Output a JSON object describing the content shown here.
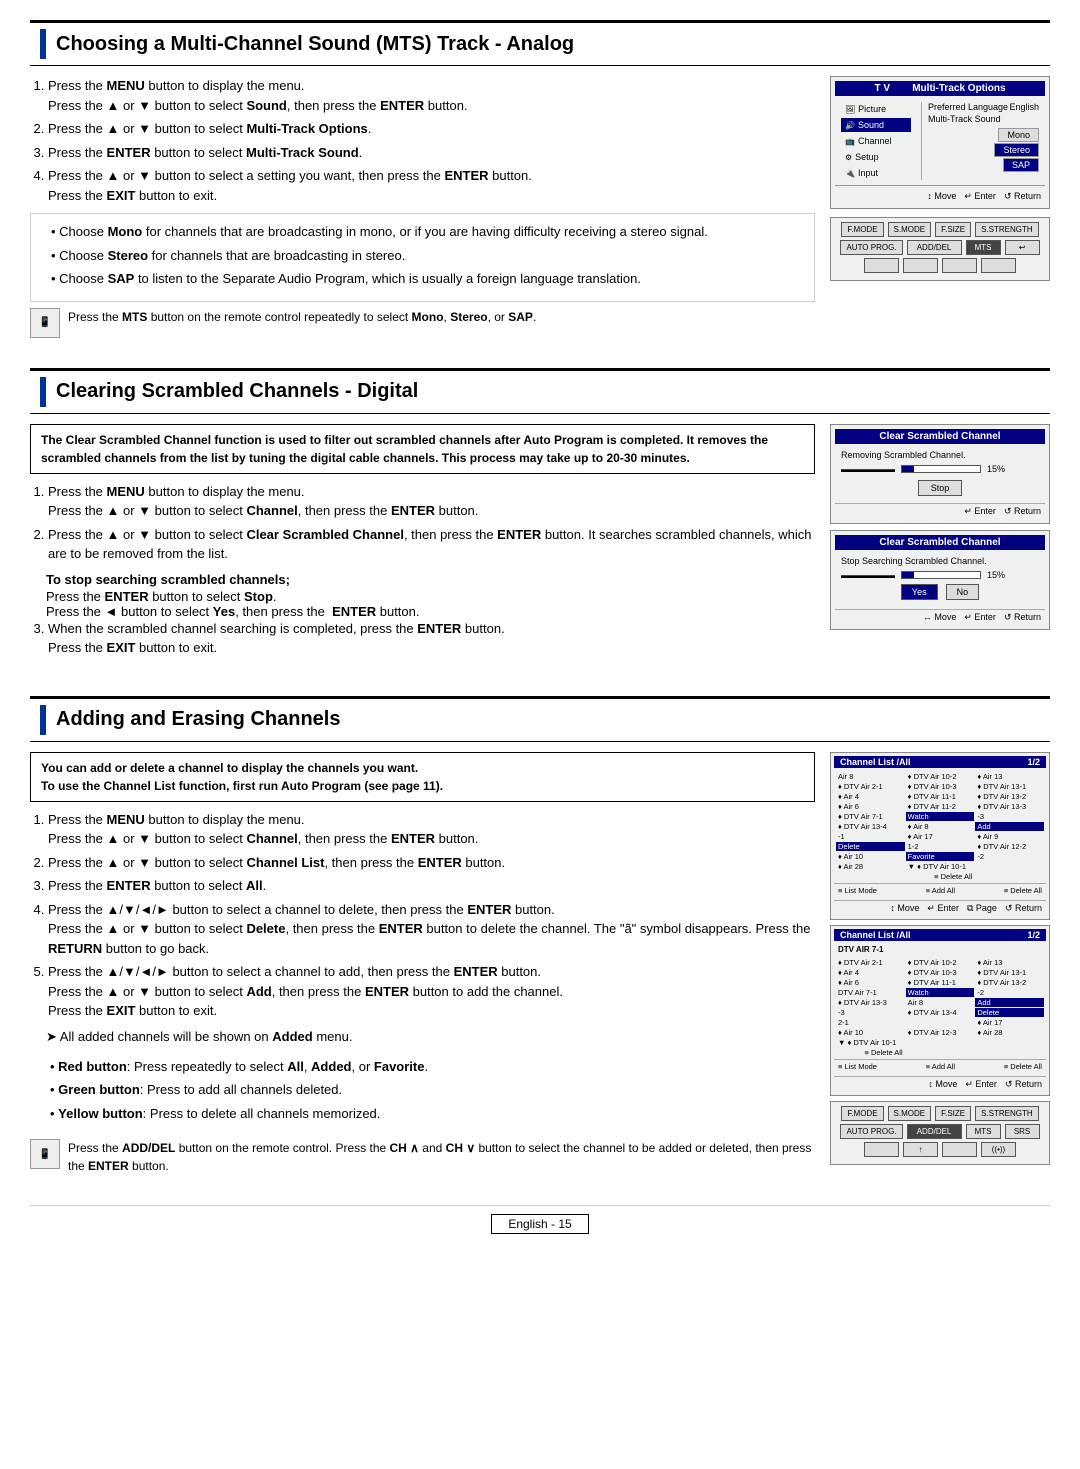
{
  "sections": [
    {
      "id": "mts",
      "title": "Choosing a Multi-Channel Sound (MTS) Track - Analog",
      "steps": [
        {
          "num": 1,
          "text": "Press the MENU button to display the menu.",
          "sub": "Press the ▲ or ▼ button to select Sound, then press the ENTER button."
        },
        {
          "num": 2,
          "text": "Press the ▲ or ▼ button to select Multi-Track Options."
        },
        {
          "num": 3,
          "text": "Press the ENTER button to select Multi-Track Sound."
        },
        {
          "num": 4,
          "text": "Press the ▲ or ▼ button to select a setting you want, then press the ENTER button.",
          "sub": "Press the EXIT button to exit."
        }
      ],
      "notes": [
        "Choose Mono for channels that are broadcasting in mono, or if you are having difficulty receiving a stereo signal.",
        "Choose Stereo for channels that are broadcasting in stereo.",
        "Choose SAP to listen to the Separate Audio Program, which is usually a foreign language translation."
      ],
      "remote_note": "Press the MTS button on the remote control repeatedly to select Mono, Stereo, or SAP."
    },
    {
      "id": "scrambled",
      "title": "Clearing Scrambled Channels - Digital",
      "warning": "The Clear Scrambled Channel function is used to filter out scrambled channels after Auto Program is completed. It removes the scrambled channels from the list by tuning the digital cable channels. This process may take up to 20-30 minutes.",
      "steps": [
        {
          "num": 1,
          "text": "Press the MENU button to display the menu.",
          "sub": "Press the ▲ or ▼ button to select Channel, then press the ENTER button."
        },
        {
          "num": 2,
          "text": "Press the ▲ or ▼ button to select Clear Scrambled Channel, then press the ENTER button. It searches scrambled channels, which are to be removed from the list."
        }
      ],
      "stop_section": {
        "title": "To stop searching scrambled channels;",
        "lines": [
          "Press the ENTER button to select Stop.",
          "Press the ◄ button to select Yes, then press the ENTER button."
        ]
      },
      "step3": "When the scrambled channel searching is completed, press the ENTER button.",
      "step3_sub": "Press the EXIT button to exit."
    },
    {
      "id": "adding",
      "title": "Adding and Erasing Channels",
      "intro1": "You can add or delete a channel to display the channels you want.",
      "intro2": "To use the Channel List function, first run Auto Program (see page 11).",
      "steps": [
        {
          "num": 1,
          "text": "Press the MENU button to display the menu.",
          "sub": "Press the ▲ or ▼ button to select Channel, then press the ENTER button."
        },
        {
          "num": 2,
          "text": "Press the ▲ or ▼ button to select Channel List, then press the ENTER button."
        },
        {
          "num": 3,
          "text": "Press the ENTER button to select All."
        },
        {
          "num": 4,
          "text": "Press the ▲/▼/◄/► button to select a channel to delete, then press the ENTER button.",
          "sub2": "Press the ▲ or ▼ button to select Delete, then press the ENTER button to delete the channel. The \"\" symbol disappears. Press the RETURN button to go back."
        },
        {
          "num": 5,
          "text": "Press the ▲/▼/◄/► button to select a channel to add, then press the ENTER button.",
          "sub2": "Press the ▲ or ▼ button to select Add, then press the ENTER button to add the channel.",
          "sub": "Press the EXIT button to exit."
        }
      ],
      "note_arrow": "➤ All added channels will be shown on Added menu.",
      "bullets": [
        "Red button: Press repeatedly to select All, Added, or Favorite.",
        "Green button: Press to add all channels deleted.",
        "Yellow button: Press to delete all channels memorized."
      ],
      "remote_note": "Press the ADD/DEL button on the remote control. Press the CH ∧ and CH ∨ button to select the channel to be added or deleted, then press the ENTER button."
    }
  ],
  "footer": {
    "label": "English - 15"
  },
  "tv_panel": {
    "title": "T V    Multi-Track Options",
    "preferred_lang": "Preferred Language",
    "lang_value": "English",
    "multi_track": "Multi-Track Sound",
    "options": [
      "Mono",
      "Stereo",
      "SAP"
    ],
    "selected": "Mono",
    "nav": "↕ Move  ↵ Enter  ↺ Return"
  },
  "scramble_panel1": {
    "title": "Clear Scrambled Channel",
    "body": "Removing Scrambled Channel.",
    "progress": 15,
    "stop_label": "Stop",
    "nav": "↵ Enter  ↺ Return"
  },
  "scramble_panel2": {
    "title": "Clear Scrambled Channel",
    "body": "Stop Searching Scrambled Channel.",
    "progress": 15,
    "yes": "Yes",
    "no": "No",
    "nav": "↔ Move  ↵ Enter  ↺ Return"
  },
  "channel_panels": {
    "panel1_title": "Channel List /All",
    "panel1_page": "1/2",
    "panel1_items": [
      "Air 8",
      "♦ DTV Air 10-2",
      "♦ Air 13",
      "♦ DTV Air 2-1",
      "♦ DTV Air 10-3",
      "♦ DTV Air 13-1",
      "♦ Air 4",
      "♦ DTV Air 11-1",
      "♦ DTV Air 13-2",
      "♦ Air 6",
      "♦ DTV Air 11-2",
      "♦ DTV Air 13-3",
      "♦ DTV Air 7-1",
      "Watch",
      "-3",
      "♦ DTV Air 13-4",
      "♦ Air 8",
      "Add",
      "-1",
      "♦ Air 17",
      "♦ Air 9",
      "Delete",
      "1-2",
      "♦ DTV Air 12-2",
      "♦ Air 10",
      "Favorite",
      "-2",
      "♦ Air 28",
      "▼ ♦ DTV Air 10-1",
      "",
      "",
      "≡ Delete All"
    ],
    "panel2_title": "Channel List /All",
    "panel2_page": "1/2",
    "panel2_items": [
      "DTV AIR 7-1",
      "",
      "",
      "",
      "♦ DTV Air 2-1",
      "♦ DTV Air 10-2",
      "♦ Air 13",
      "♦ Air 4",
      "♦ DTV Air 10-3",
      "♦ DTV Air 13-1",
      "♦ Air 6",
      "♦ DTV Air 11-1",
      "♦ DTV Air 13-2",
      "DTV Air 7-1",
      "Watch",
      "-2",
      "♦ DTV Air 13-3",
      "Air 8",
      "Add",
      "-3",
      "♦ DTV Air 13-4",
      "Delete",
      "2-1",
      "",
      "♦ Air 17",
      "♦ Air 10",
      "♦ DTV Air 12-3",
      "♦ Air 28",
      "▼ ♦ DTV Air 10-1",
      "",
      "",
      "≡ Delete All"
    ]
  }
}
